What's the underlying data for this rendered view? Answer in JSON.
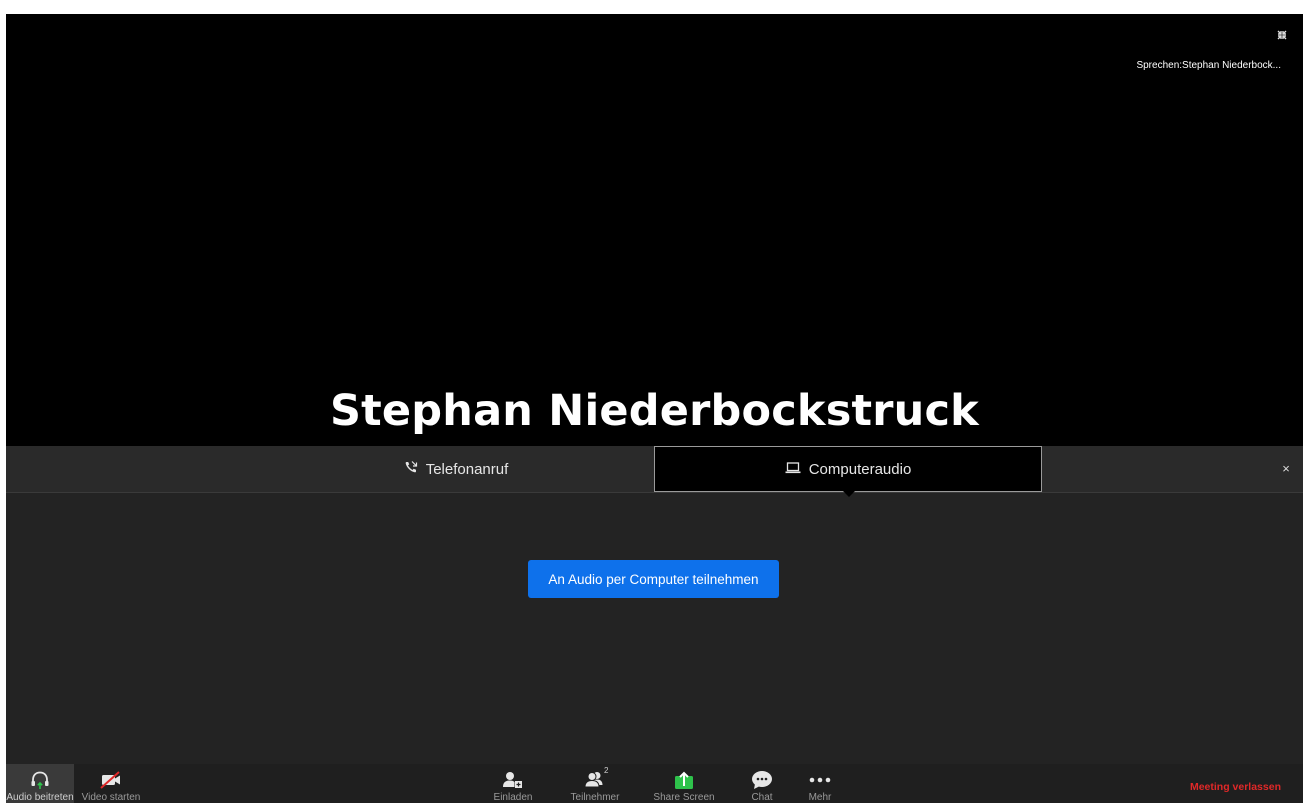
{
  "video": {
    "speaker_label": "Sprechen:Stephan Niederbock...",
    "participant_name": "Stephan Niederbockstruck"
  },
  "audio_panel": {
    "tabs": [
      {
        "label": "Telefonanruf",
        "icon": "phone-icon",
        "active": false
      },
      {
        "label": "Computeraudio",
        "icon": "laptop-icon",
        "active": true
      }
    ],
    "close_label": "×",
    "join_button_label": "An Audio per Computer teilnehmen"
  },
  "toolbar": {
    "audio_label": "Audio beitreten",
    "video_label": "Video starten",
    "invite_label": "Einladen",
    "participants_label": "Teilnehmer",
    "participants_count": "2",
    "share_label": "Share Screen",
    "chat_label": "Chat",
    "more_label": "Mehr",
    "leave_label": "Meeting verlassen"
  },
  "colors": {
    "background": "#000000",
    "panel": "#232323",
    "toolbar": "#1f1f1f",
    "primary_button": "#0e71eb",
    "share_green": "#2ec24b",
    "leave_red": "#e02828"
  }
}
